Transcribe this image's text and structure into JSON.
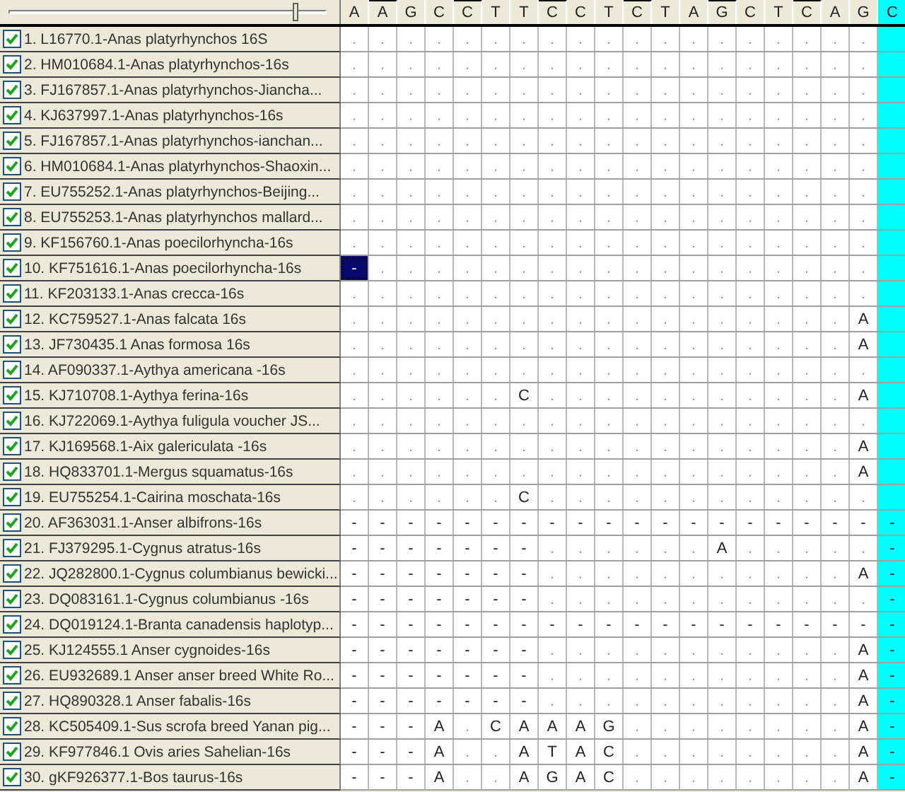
{
  "slider": {
    "level": 0.91
  },
  "columns": [
    {
      "base": "A",
      "marked": false,
      "highlighted": false
    },
    {
      "base": "A",
      "marked": true,
      "highlighted": false
    },
    {
      "base": "G",
      "marked": false,
      "highlighted": false
    },
    {
      "base": "C",
      "marked": false,
      "highlighted": false
    },
    {
      "base": "C",
      "marked": true,
      "highlighted": false
    },
    {
      "base": "T",
      "marked": false,
      "highlighted": false
    },
    {
      "base": "T",
      "marked": false,
      "highlighted": false
    },
    {
      "base": "C",
      "marked": true,
      "highlighted": false
    },
    {
      "base": "C",
      "marked": false,
      "highlighted": false
    },
    {
      "base": "T",
      "marked": false,
      "highlighted": false
    },
    {
      "base": "C",
      "marked": true,
      "highlighted": false
    },
    {
      "base": "T",
      "marked": false,
      "highlighted": false
    },
    {
      "base": "A",
      "marked": false,
      "highlighted": false
    },
    {
      "base": "G",
      "marked": true,
      "highlighted": false
    },
    {
      "base": "C",
      "marked": false,
      "highlighted": false
    },
    {
      "base": "T",
      "marked": false,
      "highlighted": false
    },
    {
      "base": "C",
      "marked": true,
      "highlighted": false
    },
    {
      "base": "A",
      "marked": false,
      "highlighted": false
    },
    {
      "base": "G",
      "marked": false,
      "highlighted": false
    },
    {
      "base": "C",
      "marked": false,
      "highlighted": true
    }
  ],
  "rows": [
    {
      "name": "1. L16770.1-Anas platyrhynchos 16S",
      "checked": true,
      "selected": false,
      "cells": [
        ".",
        ".",
        ".",
        ".",
        ".",
        ".",
        ".",
        ".",
        ".",
        ".",
        ".",
        ".",
        ".",
        ".",
        ".",
        ".",
        ".",
        ".",
        "."
      ]
    },
    {
      "name": "2. HM010684.1-Anas platyrhynchos-16s",
      "checked": true,
      "selected": false,
      "cells": [
        ".",
        ".",
        ".",
        ".",
        ".",
        ".",
        ".",
        ".",
        ".",
        ".",
        ".",
        ".",
        ".",
        ".",
        ".",
        ".",
        ".",
        ".",
        "."
      ]
    },
    {
      "name": "3. FJ167857.1-Anas platyrhynchos-Jiancha...",
      "checked": true,
      "selected": false,
      "cells": [
        ".",
        ".",
        ".",
        ".",
        ".",
        ".",
        ".",
        ".",
        ".",
        ".",
        ".",
        ".",
        ".",
        ".",
        ".",
        ".",
        ".",
        ".",
        "."
      ]
    },
    {
      "name": "4. KJ637997.1-Anas platyrhynchos-16s",
      "checked": true,
      "selected": false,
      "cells": [
        ".",
        ".",
        ".",
        ".",
        ".",
        ".",
        ".",
        ".",
        ".",
        ".",
        ".",
        ".",
        ".",
        ".",
        ".",
        ".",
        ".",
        ".",
        "."
      ]
    },
    {
      "name": "5. FJ167857.1-Anas platyrhynchos-ianchan...",
      "checked": true,
      "selected": false,
      "cells": [
        ".",
        ".",
        ".",
        ".",
        ".",
        ".",
        ".",
        ".",
        ".",
        ".",
        ".",
        ".",
        ".",
        ".",
        ".",
        ".",
        ".",
        ".",
        "."
      ]
    },
    {
      "name": "6. HM010684.1-Anas platyrhynchos-Shaoxin...",
      "checked": true,
      "selected": false,
      "cells": [
        ".",
        ".",
        ".",
        ".",
        ".",
        ".",
        ".",
        ".",
        ".",
        ".",
        ".",
        ".",
        ".",
        ".",
        ".",
        ".",
        ".",
        ".",
        "."
      ]
    },
    {
      "name": "7. EU755252.1-Anas platyrhynchos-Beijing...",
      "checked": true,
      "selected": false,
      "cells": [
        ".",
        ".",
        ".",
        ".",
        ".",
        ".",
        ".",
        ".",
        ".",
        ".",
        ".",
        ".",
        ".",
        ".",
        ".",
        ".",
        ".",
        ".",
        "."
      ]
    },
    {
      "name": "8. EU755253.1-Anas platyrhynchos mallard...",
      "checked": true,
      "selected": false,
      "cells": [
        ".",
        ".",
        ".",
        ".",
        ".",
        ".",
        ".",
        ".",
        ".",
        ".",
        ".",
        ".",
        ".",
        ".",
        ".",
        ".",
        ".",
        ".",
        "."
      ]
    },
    {
      "name": "9. KF156760.1-Anas poecilorhyncha-16s",
      "checked": true,
      "selected": false,
      "cells": [
        ".",
        ".",
        ".",
        ".",
        ".",
        ".",
        ".",
        ".",
        ".",
        ".",
        ".",
        ".",
        ".",
        ".",
        ".",
        ".",
        ".",
        ".",
        "."
      ]
    },
    {
      "name": "10. KF751616.1-Anas poecilorhyncha-16s",
      "checked": true,
      "selected": true,
      "cells": [
        "-",
        ".",
        ".",
        ".",
        ".",
        ".",
        ".",
        ".",
        ".",
        ".",
        ".",
        ".",
        ".",
        ".",
        ".",
        ".",
        ".",
        ".",
        "."
      ]
    },
    {
      "name": "11. KF203133.1-Anas crecca-16s",
      "checked": true,
      "selected": false,
      "cells": [
        ".",
        ".",
        ".",
        ".",
        ".",
        ".",
        ".",
        ".",
        ".",
        ".",
        ".",
        ".",
        ".",
        ".",
        ".",
        ".",
        ".",
        ".",
        "."
      ]
    },
    {
      "name": "12. KC759527.1-Anas falcata 16s",
      "checked": true,
      "selected": false,
      "cells": [
        ".",
        ".",
        ".",
        ".",
        ".",
        ".",
        ".",
        ".",
        ".",
        ".",
        ".",
        ".",
        ".",
        ".",
        ".",
        ".",
        ".",
        ".",
        "A"
      ]
    },
    {
      "name": "13. JF730435.1 Anas formosa 16s",
      "checked": true,
      "selected": false,
      "cells": [
        ".",
        ".",
        ".",
        ".",
        ".",
        ".",
        ".",
        ".",
        ".",
        ".",
        ".",
        ".",
        ".",
        ".",
        ".",
        ".",
        ".",
        ".",
        "A"
      ]
    },
    {
      "name": "14. AF090337.1-Aythya americana -16s",
      "checked": true,
      "selected": false,
      "cells": [
        ".",
        ".",
        ".",
        ".",
        ".",
        ".",
        ".",
        ".",
        ".",
        ".",
        ".",
        ".",
        ".",
        ".",
        ".",
        ".",
        ".",
        ".",
        "."
      ]
    },
    {
      "name": "15. KJ710708.1-Aythya ferina-16s",
      "checked": true,
      "selected": false,
      "cells": [
        ".",
        ".",
        ".",
        ".",
        ".",
        ".",
        "C",
        ".",
        ".",
        ".",
        ".",
        ".",
        ".",
        ".",
        ".",
        ".",
        ".",
        ".",
        "A"
      ]
    },
    {
      "name": "16. KJ722069.1-Aythya fuligula voucher JS...",
      "checked": true,
      "selected": false,
      "cells": [
        ".",
        ".",
        ".",
        ".",
        ".",
        ".",
        ".",
        ".",
        ".",
        ".",
        ".",
        ".",
        ".",
        ".",
        ".",
        ".",
        ".",
        ".",
        "."
      ]
    },
    {
      "name": "17. KJ169568.1-Aix galericulata -16s",
      "checked": true,
      "selected": false,
      "cells": [
        ".",
        ".",
        ".",
        ".",
        ".",
        ".",
        ".",
        ".",
        ".",
        ".",
        ".",
        ".",
        ".",
        ".",
        ".",
        ".",
        ".",
        ".",
        "A"
      ]
    },
    {
      "name": "18. HQ833701.1-Mergus squamatus-16s",
      "checked": true,
      "selected": false,
      "cells": [
        ".",
        ".",
        ".",
        ".",
        ".",
        ".",
        ".",
        ".",
        ".",
        ".",
        ".",
        ".",
        ".",
        ".",
        ".",
        ".",
        ".",
        ".",
        "A"
      ]
    },
    {
      "name": "19. EU755254.1-Cairina moschata-16s",
      "checked": true,
      "selected": false,
      "cells": [
        ".",
        ".",
        ".",
        ".",
        ".",
        ".",
        "C",
        ".",
        ".",
        ".",
        ".",
        ".",
        ".",
        ".",
        ".",
        ".",
        ".",
        ".",
        "."
      ]
    },
    {
      "name": "20. AF363031.1-Anser albifrons-16s",
      "checked": true,
      "selected": false,
      "cells": [
        "-",
        "-",
        "-",
        "-",
        "-",
        "-",
        "-",
        "-",
        "-",
        "-",
        "-",
        "-",
        "-",
        "-",
        "-",
        "-",
        "-",
        "-",
        "-",
        "-"
      ]
    },
    {
      "name": "21. FJ379295.1-Cygnus atratus-16s",
      "checked": true,
      "selected": false,
      "cells": [
        "-",
        "-",
        "-",
        "-",
        "-",
        "-",
        "-",
        ".",
        ".",
        ".",
        ".",
        ".",
        ".",
        "A",
        ".",
        ".",
        ".",
        ".",
        ".",
        "-"
      ]
    },
    {
      "name": "22. JQ282800.1-Cygnus columbianus bewicki...",
      "checked": true,
      "selected": false,
      "cells": [
        "-",
        "-",
        "-",
        "-",
        "-",
        "-",
        "-",
        ".",
        ".",
        ".",
        ".",
        ".",
        ".",
        ".",
        ".",
        ".",
        ".",
        ".",
        "A",
        "-"
      ]
    },
    {
      "name": "23. DQ083161.1-Cygnus columbianus -16s",
      "checked": true,
      "selected": false,
      "cells": [
        "-",
        "-",
        "-",
        "-",
        "-",
        "-",
        "-",
        ".",
        ".",
        ".",
        ".",
        ".",
        ".",
        ".",
        ".",
        ".",
        ".",
        ".",
        ".",
        "-"
      ]
    },
    {
      "name": "24. DQ019124.1-Branta canadensis haplotyp...",
      "checked": true,
      "selected": false,
      "cells": [
        "-",
        "-",
        "-",
        "-",
        "-",
        "-",
        "-",
        "-",
        "-",
        "-",
        "-",
        "-",
        "-",
        "-",
        "-",
        "-",
        "-",
        "-",
        "-",
        "-"
      ]
    },
    {
      "name": "25. KJ124555.1 Anser cygnoides-16s",
      "checked": true,
      "selected": false,
      "cells": [
        "-",
        "-",
        "-",
        "-",
        "-",
        "-",
        "-",
        ".",
        ".",
        ".",
        ".",
        ".",
        ".",
        ".",
        ".",
        ".",
        ".",
        ".",
        "A",
        "-"
      ]
    },
    {
      "name": "26. EU932689.1 Anser anser breed White Ro...",
      "checked": true,
      "selected": false,
      "cells": [
        "-",
        "-",
        "-",
        "-",
        "-",
        "-",
        "-",
        ".",
        ".",
        ".",
        ".",
        ".",
        ".",
        ".",
        ".",
        ".",
        ".",
        ".",
        "A",
        "-"
      ]
    },
    {
      "name": "27. HQ890328.1 Anser fabalis-16s",
      "checked": true,
      "selected": false,
      "cells": [
        "-",
        "-",
        "-",
        "-",
        "-",
        "-",
        "-",
        ".",
        ".",
        ".",
        ".",
        ".",
        ".",
        ".",
        ".",
        ".",
        ".",
        ".",
        "A",
        "-"
      ]
    },
    {
      "name": "28. KC505409.1-Sus scrofa breed Yanan pig...",
      "checked": true,
      "selected": false,
      "cells": [
        "-",
        "-",
        "-",
        "A",
        ".",
        "C",
        "A",
        "A",
        "A",
        "G",
        ".",
        ".",
        ".",
        ".",
        ".",
        ".",
        ".",
        ".",
        "A",
        "-"
      ]
    },
    {
      "name": "29. KF977846.1 Ovis aries Sahelian-16s",
      "checked": true,
      "selected": false,
      "cells": [
        "-",
        "-",
        "-",
        "A",
        ".",
        ".",
        "A",
        "T",
        "A",
        "C",
        ".",
        ".",
        ".",
        ".",
        ".",
        ".",
        ".",
        ".",
        "A",
        "-"
      ]
    },
    {
      "name": "30. gKF926377.1-Bos taurus-16s",
      "checked": true,
      "selected": false,
      "cells": [
        "-",
        "-",
        "-",
        "A",
        ".",
        ".",
        "A",
        "G",
        "A",
        "C",
        ".",
        ".",
        ".",
        ".",
        ".",
        ".",
        ".",
        ".",
        "A",
        "-"
      ]
    }
  ]
}
